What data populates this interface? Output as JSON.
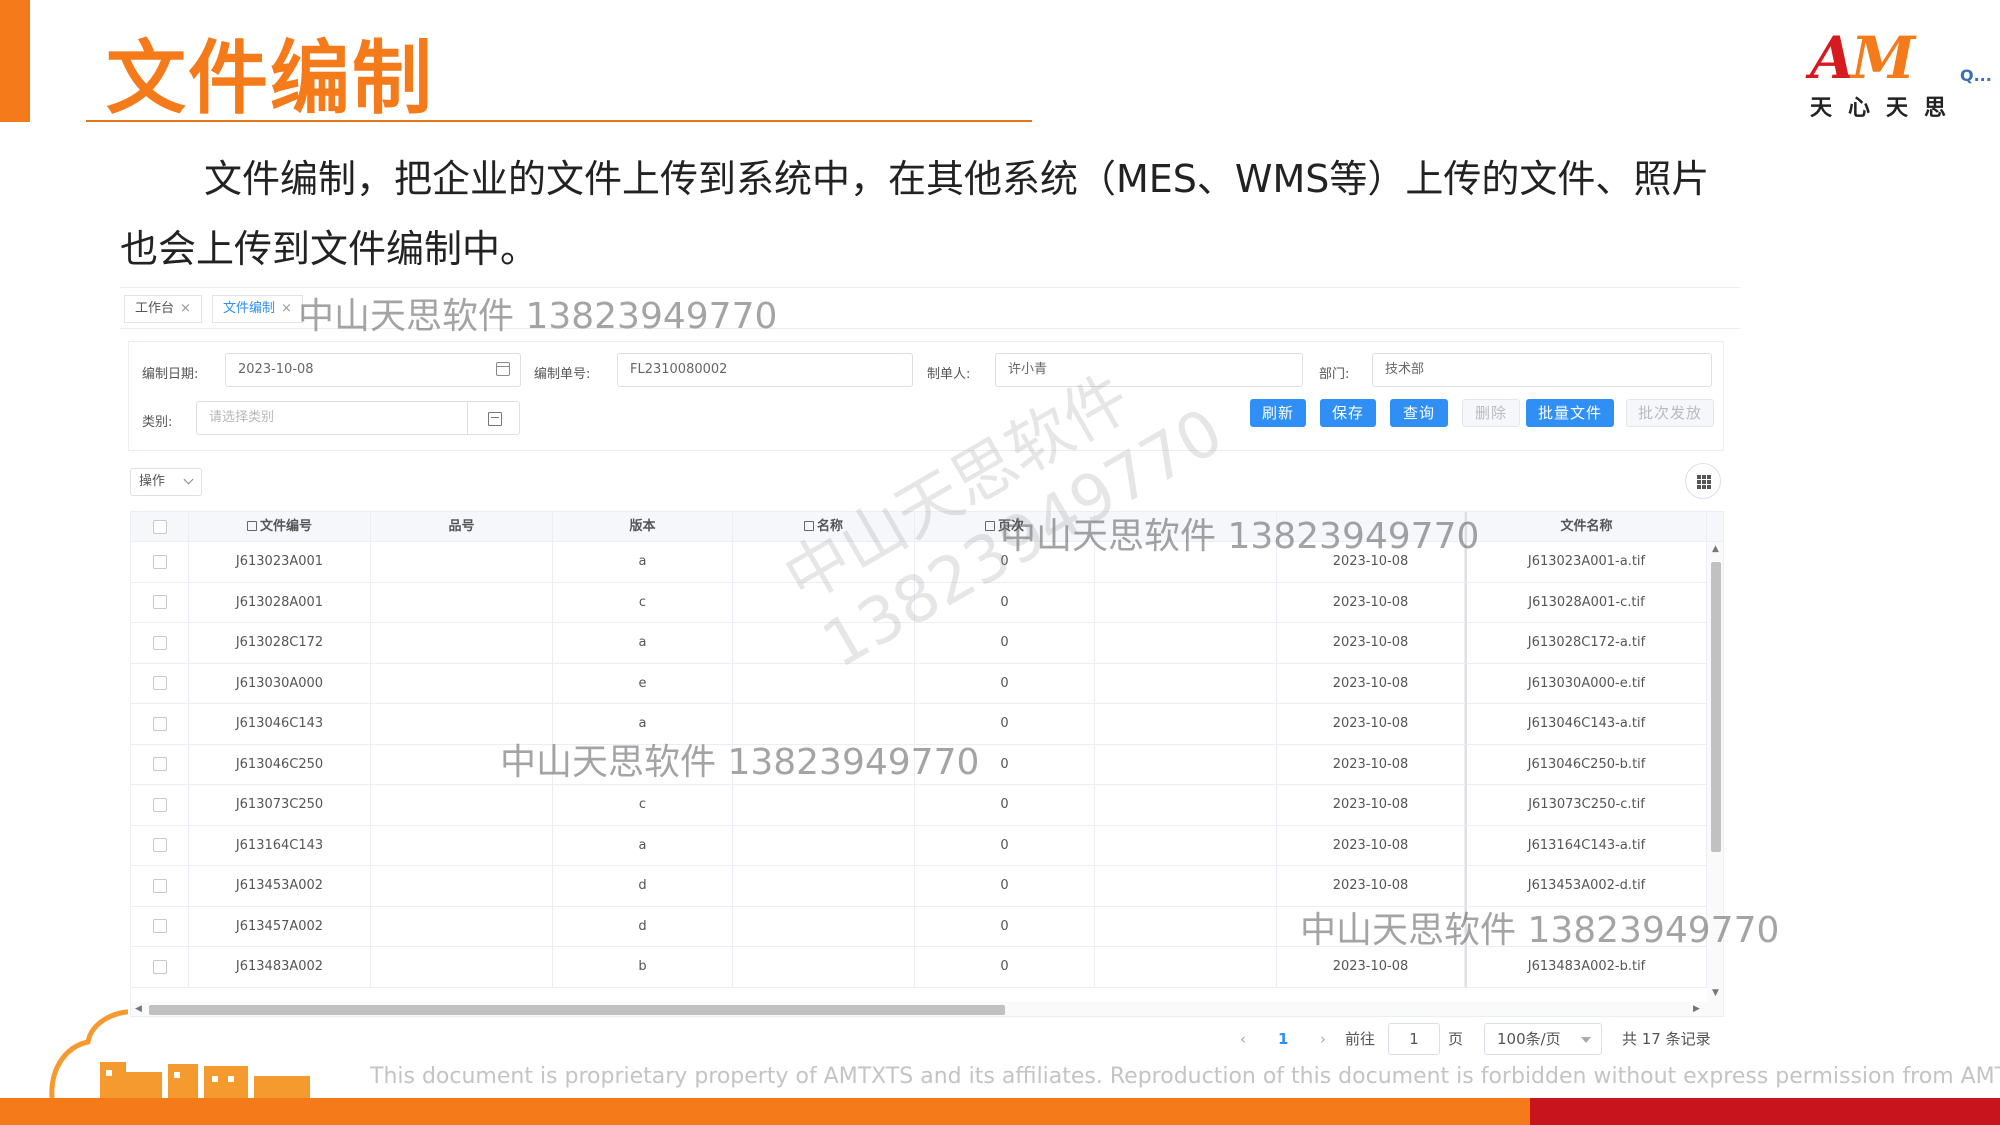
{
  "slide": {
    "title": "文件编制",
    "intro": "文件编制，把企业的文件上传到系统中，在其他系统（MES、WMS等）上传的文件、照片也会上传到文件编制中。",
    "logo_mark_a": "A",
    "logo_mark_m": "M",
    "logo_q": "Q...",
    "logo_subtitle": "天心天思",
    "footer_text": "This document is proprietary property of AMTXTS and its affiliates. Reproduction of this document is forbidden without express permission from AMTXTS",
    "accent_color": "#f47a1a",
    "brand_red": "#c8141d"
  },
  "tabs": [
    {
      "label": "工作台",
      "close": "×"
    },
    {
      "label": "文件编制",
      "close": "×"
    }
  ],
  "form": {
    "date_label": "编制日期:",
    "date_value": "2023-10-08",
    "order_label": "编制单号:",
    "order_value": "FL2310080002",
    "maker_label": "制单人:",
    "maker_value": "许小青",
    "dept_label": "部门:",
    "dept_value": "技术部",
    "category_label": "类别:",
    "category_placeholder": "请选择类别"
  },
  "buttons": {
    "refresh": "刷新",
    "save": "保存",
    "query": "查询",
    "delete": "删除",
    "batch_file": "批量文件",
    "batch_issue": "批次发放"
  },
  "operation_dropdown": "操作",
  "table": {
    "columns": [
      "文件编号",
      "品号",
      "版本",
      "名称",
      "页次",
      "",
      "",
      "文件名称"
    ],
    "rows": [
      {
        "code": "J613023A001",
        "part": "",
        "ver": "a",
        "name": "",
        "page": "0",
        "date": "2023-10-08",
        "file": "J613023A001-a.tif"
      },
      {
        "code": "J613028A001",
        "part": "",
        "ver": "c",
        "name": "",
        "page": "0",
        "date": "2023-10-08",
        "file": "J613028A001-c.tif"
      },
      {
        "code": "J613028C172",
        "part": "",
        "ver": "a",
        "name": "",
        "page": "0",
        "date": "2023-10-08",
        "file": "J613028C172-a.tif"
      },
      {
        "code": "J613030A000",
        "part": "",
        "ver": "e",
        "name": "",
        "page": "0",
        "date": "2023-10-08",
        "file": "J613030A000-e.tif"
      },
      {
        "code": "J613046C143",
        "part": "",
        "ver": "a",
        "name": "",
        "page": "0",
        "date": "2023-10-08",
        "file": "J613046C143-a.tif"
      },
      {
        "code": "J613046C250",
        "part": "",
        "ver": "",
        "name": "",
        "page": "0",
        "date": "2023-10-08",
        "file": "J613046C250-b.tif"
      },
      {
        "code": "J613073C250",
        "part": "",
        "ver": "c",
        "name": "",
        "page": "0",
        "date": "2023-10-08",
        "file": "J613073C250-c.tif"
      },
      {
        "code": "J613164C143",
        "part": "",
        "ver": "a",
        "name": "",
        "page": "0",
        "date": "2023-10-08",
        "file": "J613164C143-a.tif"
      },
      {
        "code": "J613453A002",
        "part": "",
        "ver": "d",
        "name": "",
        "page": "0",
        "date": "2023-10-08",
        "file": "J613453A002-d.tif"
      },
      {
        "code": "J613457A002",
        "part": "",
        "ver": "d",
        "name": "",
        "page": "0",
        "date": "",
        "file": ""
      },
      {
        "code": "J613483A002",
        "part": "",
        "ver": "b",
        "name": "",
        "page": "0",
        "date": "2023-10-08",
        "file": "J613483A002-b.tif"
      }
    ]
  },
  "pagination": {
    "prev": "‹",
    "current": "1",
    "next": "›",
    "goto_label": "前往",
    "goto_value": "1",
    "page_unit": "页",
    "page_size": "100条/页",
    "total": "共 17 条记录"
  },
  "watermarks": {
    "text": "中山天思软件 13823949770",
    "diag_line1": "中山天思软件",
    "diag_line2": "13823949770"
  }
}
